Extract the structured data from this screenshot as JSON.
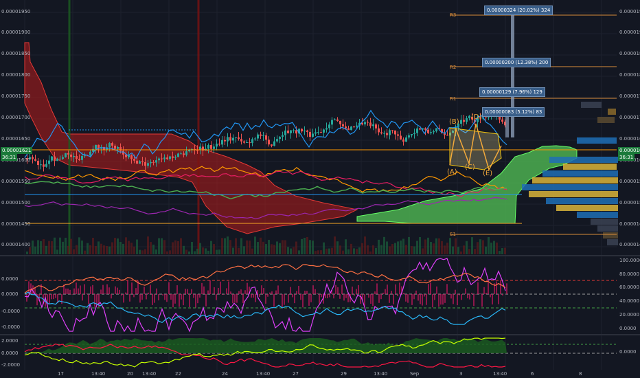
{
  "price_axis": {
    "left": [
      "0.00001950",
      "0.00001900",
      "0.00001850",
      "0.00001800",
      "0.00001750",
      "0.00001700",
      "0.00001650",
      "0.00001600",
      "0.00001550",
      "0.00001500",
      "0.00001450",
      "0.00001400"
    ],
    "right": [
      "0.00001950",
      "0.00001900",
      "0.00001850",
      "0.00001800",
      "0.00001750",
      "0.00001700",
      "0.00001650",
      "0.00001600",
      "0.00001550",
      "0.00001500",
      "0.00001450",
      "0.00001400"
    ],
    "current_price": "0.00001621",
    "countdown": "36:31"
  },
  "indicator_axis": {
    "left": [
      "0.0000",
      "0.0000",
      "-0.0000",
      "-0.0000"
    ],
    "right": [
      "100.0000",
      "80.0000",
      "60.0000",
      "40.0000",
      "20.0000",
      "0.0000"
    ]
  },
  "oscillator_axis": {
    "left": [
      "2.0000",
      "0.0000",
      "-2.0000"
    ],
    "right": [
      "0.0000"
    ]
  },
  "x_axis": [
    "17",
    "13:40",
    "20",
    "13:40",
    "22",
    "24",
    "13:40",
    "27",
    "29",
    "13:40",
    "Sep",
    "3",
    "13:40",
    "6",
    "8"
  ],
  "pivots": [
    "R3",
    "R2",
    "R1",
    "S1"
  ],
  "targets": [
    "0.00000324 (20.02%) 324",
    "0.00000200 (12.38%) 200",
    "0.00000129 (7.96%) 129",
    "0.00000083 (5.12%) 83"
  ],
  "waves": [
    "(A)",
    "(B)",
    "(C)",
    "(D)",
    "(E)"
  ],
  "colors": {
    "background": "#131722",
    "up": "#26a69a",
    "down": "#ef5350",
    "cloud_red": "#b71c1c",
    "cloud_green": "#4caf50",
    "price_badge": "#1b7a3a",
    "target_box": "#3a5f8a",
    "pivot": "#d98c3a"
  }
}
